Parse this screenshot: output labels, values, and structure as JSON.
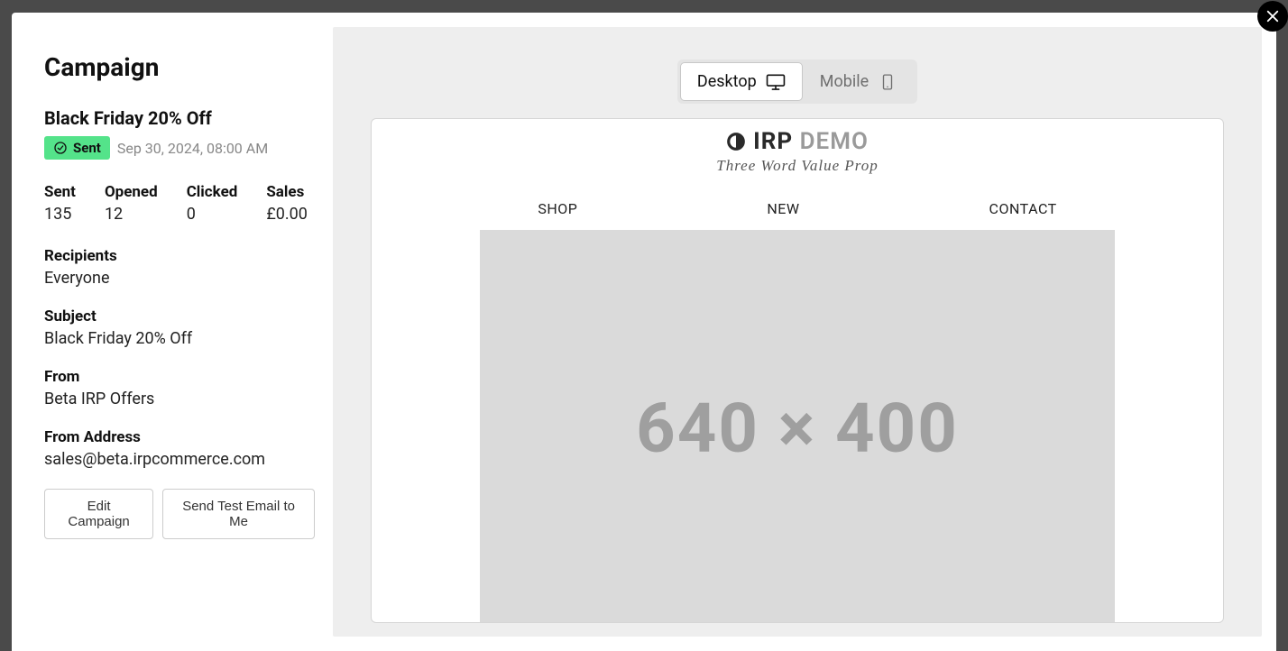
{
  "header": {
    "title": "Campaign"
  },
  "campaign": {
    "name": "Black Friday 20% Off",
    "status_label": "Sent",
    "status_date": "Sep 30, 2024, 08:00 AM"
  },
  "stats": {
    "sent_label": "Sent",
    "sent_value": "135",
    "opened_label": "Opened",
    "opened_value": "12",
    "clicked_label": "Clicked",
    "clicked_value": "0",
    "sales_label": "Sales",
    "sales_value": "£0.00"
  },
  "details": {
    "recipients_label": "Recipients",
    "recipients_value": "Everyone",
    "subject_label": "Subject",
    "subject_value": "Black Friday 20% Off",
    "from_label": "From",
    "from_value": "Beta IRP Offers",
    "from_address_label": "From Address",
    "from_address_value": "sales@beta.irpcommerce.com"
  },
  "buttons": {
    "edit": "Edit Campaign",
    "send_test": "Send Test Email to Me"
  },
  "device": {
    "desktop": "Desktop",
    "mobile": "Mobile"
  },
  "preview": {
    "brand_a": "IRP",
    "brand_b": "DEMO",
    "tagline": "Three Word Value Prop",
    "nav": {
      "shop": "SHOP",
      "new": "NEW",
      "contact": "CONTACT"
    },
    "hero_placeholder": "640 × 400"
  }
}
